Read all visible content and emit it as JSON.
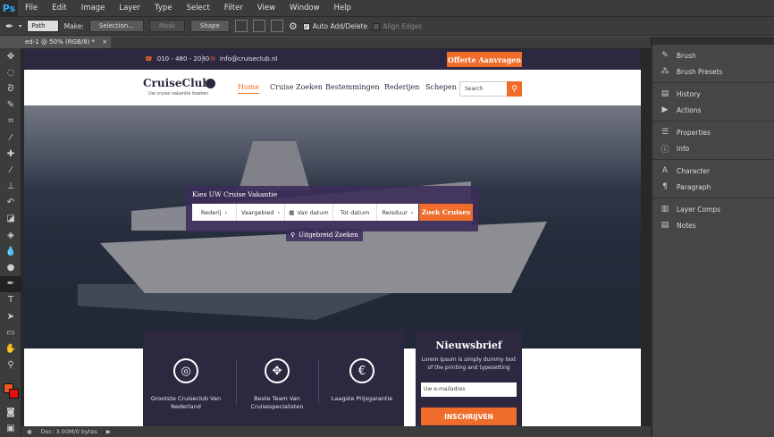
{
  "app": {
    "logo": "Ps"
  },
  "menu": [
    "File",
    "Edit",
    "Image",
    "Layer",
    "Type",
    "Select",
    "Filter",
    "View",
    "Window",
    "Help"
  ],
  "options": {
    "mode_value": "Path",
    "make_label": "Make:",
    "selection_label": "Selection...",
    "mask_label": "Mask",
    "shape_label": "Shape",
    "auto_add_delete": "Auto Add/Delete",
    "align_edges": "Align Edges"
  },
  "document": {
    "tab_title": "ed-1 @ 50% (RGB/8) *",
    "close": "×",
    "status": "Doc: 3.00M/0 bytes"
  },
  "colors": {
    "foreground": "#e85a1b",
    "background": "#e01010",
    "accent": "#ef6c2b",
    "dark": "#2d2740"
  },
  "panels": [
    {
      "items": [
        {
          "icon": "brush-icon",
          "label": "Brush"
        },
        {
          "icon": "brush-presets-icon",
          "label": "Brush Presets"
        }
      ]
    },
    {
      "items": [
        {
          "icon": "history-icon",
          "label": "History"
        },
        {
          "icon": "actions-icon",
          "label": "Actions"
        }
      ]
    },
    {
      "items": [
        {
          "icon": "properties-icon",
          "label": "Properties"
        },
        {
          "icon": "info-icon",
          "label": "Info"
        }
      ]
    },
    {
      "items": [
        {
          "icon": "character-icon",
          "label": "Character"
        },
        {
          "icon": "paragraph-icon",
          "label": "Paragraph"
        }
      ]
    },
    {
      "items": [
        {
          "icon": "layer-comps-icon",
          "label": "Layer Comps"
        },
        {
          "icon": "notes-icon",
          "label": "Notes"
        }
      ]
    }
  ],
  "site": {
    "phone": "010 - 480 - 2080",
    "email": "info@cruiseclub.nl",
    "quote_button": "Offerte Aanvragen",
    "logo_name": "CruiseClub",
    "logo_tagline": "Uw cruise vakantie boeken",
    "nav": [
      "Home",
      "Cruise Zoeken",
      "Bestemmingen",
      "Rederijen",
      "Schepen"
    ],
    "search_placeholder": "Search",
    "search_panel": {
      "title": "Kies UW Cruise Vakantie",
      "fields": [
        "Rederij",
        "Vaargebied",
        "Van datum",
        "Tot datum",
        "Reisduur"
      ],
      "button": "Zoek Cruises"
    },
    "advanced_search": "Uitgebreid Zoeken",
    "features": [
      {
        "icon": "lifebuoy-icon",
        "label": "Grootste Cruiseclub Van Nederland"
      },
      {
        "icon": "compass-icon",
        "label": "Beste Team Van Cruisespecialisten"
      },
      {
        "icon": "euro-icon",
        "label": "Laagste Prijsgarantie"
      }
    ],
    "newsletter": {
      "title": "Nieuwsbrief",
      "text": "Lorem Ipsum is simply dummy text of the printing and typesetting",
      "placeholder": "Uw e-mailadres",
      "button": "INSCHRIJVEN"
    }
  }
}
